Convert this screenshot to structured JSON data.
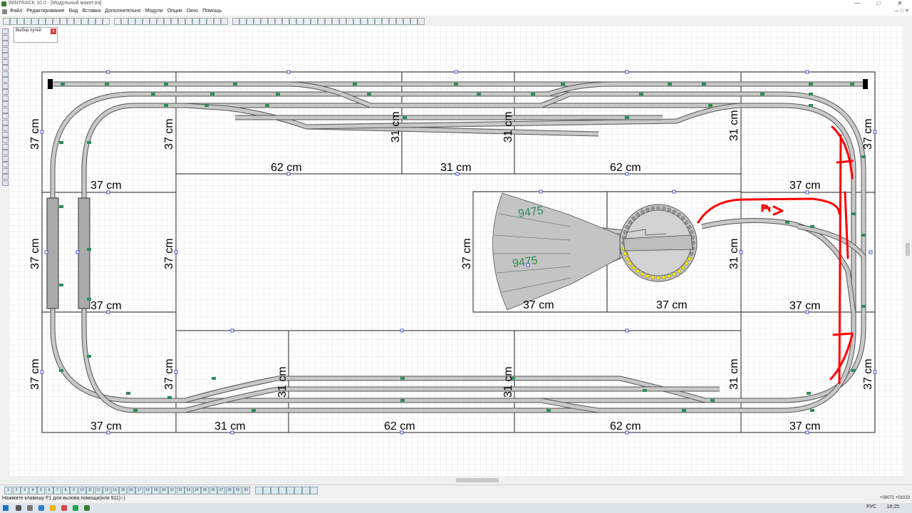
{
  "window": {
    "title": "WINTRACK 10.0 - [Модульный макет.tra]",
    "controls": [
      "—",
      "□",
      "✕"
    ]
  },
  "menu": {
    "items": [
      "Файл",
      "Редактирование",
      "Вид",
      "Вставка",
      "Дополнительно",
      "Модули",
      "Опции",
      "Окно",
      "Помощь"
    ],
    "right_controls": "— □ ✕"
  },
  "panel": {
    "title": "Выбор путей",
    "close": "x"
  },
  "layout": {
    "module_labels": {
      "top": [
        "62 cm",
        "31 cm",
        "62 cm"
      ],
      "bottom": [
        "37 cm",
        "31 cm",
        "62 cm",
        "62 cm",
        "37 cm"
      ],
      "left_corner_top": "37 cm",
      "left_corner_bottom": "37 cm",
      "left_vertical": [
        "37 cm",
        "37 cm",
        "37 cm"
      ],
      "right_corner_top": "37 cm",
      "right_corner_bottom": "37 cm",
      "right_vertical": [
        "37 cm",
        "37 cm"
      ],
      "inner_vertical": [
        "37 cm",
        "37 cm",
        "37 cm",
        "31 cm",
        "31 cm",
        "31 cm"
      ],
      "turntable_module": [
        "37 cm",
        "37 cm",
        "37 cm"
      ],
      "rotated_small": [
        "31 cm",
        "31 cm",
        "31 cm",
        "31 cm"
      ]
    },
    "turntable_labels": [
      "9475",
      "9475"
    ],
    "annotation_text": "A>"
  },
  "colors": {
    "track": "#c8c8c8",
    "track_edge": "#666666",
    "grid": "#d4d4d4",
    "annotation": "#ff0000",
    "connector": "#2e8b57",
    "turntable_dot": "#ffee00",
    "label_green": "#2e8b57"
  },
  "layer_bar": {
    "tabs": [
      "1",
      "2",
      "3",
      "4",
      "5",
      "6",
      "7",
      "8",
      "9",
      "10",
      "11",
      "12",
      "13",
      "14",
      "15",
      "16",
      "17",
      "18",
      "19",
      "20",
      "21",
      "22",
      "23",
      "24",
      "25",
      "26",
      "27",
      "28",
      "29",
      "30"
    ]
  },
  "status": {
    "message": "Нажмите клавишу F1 для вызова помощи(или 911):-)",
    "coords": "+00071 +01023"
  },
  "taskbar": {
    "lang": "РУС",
    "time": "18:25"
  }
}
